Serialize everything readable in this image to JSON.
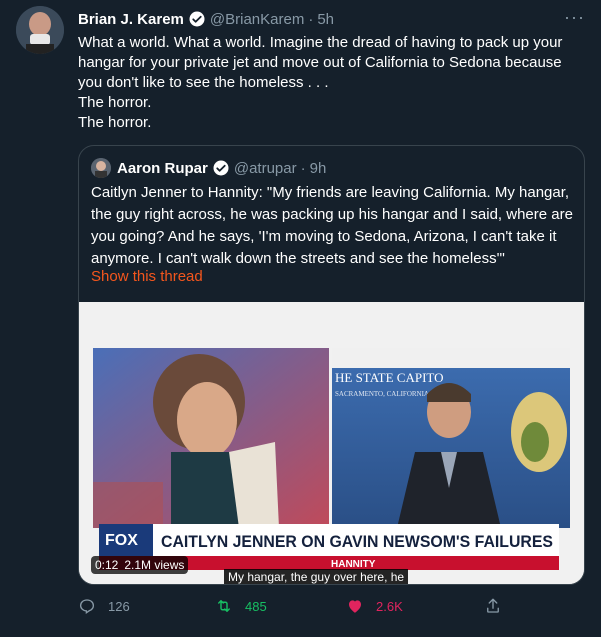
{
  "tweet": {
    "author_name": "Brian J. Karem",
    "author_handle": "@BrianKarem",
    "separator": "·",
    "timestamp": "5h",
    "more_label": "···",
    "lines": [
      "What a world. What a world. Imagine the dread of having to pack up your",
      "hangar for your private jet and move out of California to Sedona because",
      "you don't like to see the homeless . . .",
      "The horror.",
      "The horror."
    ]
  },
  "quote": {
    "author_name": "Aaron Rupar",
    "author_handle": "@atrupar",
    "separator": "·",
    "timestamp": "9h",
    "lines": [
      "Caitlyn Jenner to Hannity: \"My friends are leaving California. My hangar,",
      "the guy right across, he was packing up his hangar and I said, where are",
      "you going? And he says, 'I'm moving to Sedona, Arizona, I can't take it",
      "anymore. I can't walk down the streets and see the homeless'\""
    ],
    "show_thread": "Show this thread"
  },
  "video": {
    "time": "0:12",
    "views": "2.1M views",
    "caption": "My hangar, the guy over here, he",
    "banner": "CAITLYN JENNER ON GAVIN NEWSOM'S FAILURES",
    "network": "FOX",
    "show": "HANNITY",
    "backdrop": "HE STATE CAPITO",
    "backdrop_sub": "SACRAMENTO, CALIFORNIA"
  },
  "actions": {
    "replies": "126",
    "retweets": "485",
    "likes": "2.6K"
  },
  "colors": {
    "background": "#15202b",
    "muted": "#8899a6",
    "verified": "#1da1f2",
    "retweet": "#17bf63",
    "like": "#e0245e",
    "link": "#f4561d"
  }
}
